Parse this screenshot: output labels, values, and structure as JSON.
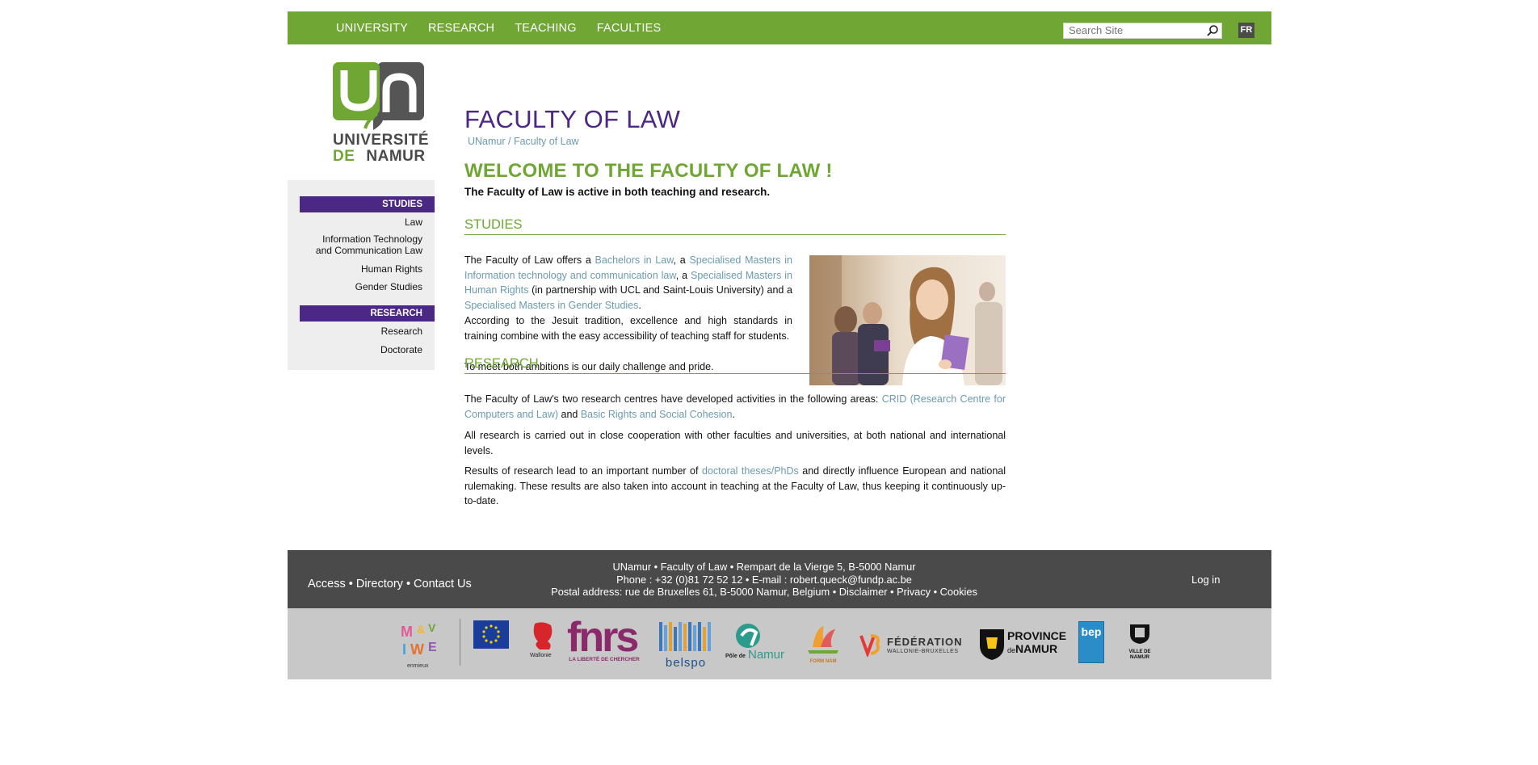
{
  "nav": {
    "items": [
      "UNIVERSITY",
      "RESEARCH",
      "TEACHING",
      "FACULTIES"
    ]
  },
  "search": {
    "placeholder": "Search Site"
  },
  "lang": {
    "label": "FR"
  },
  "logo": {
    "line1": "UNIVERSITÉ",
    "line2_de": "DE",
    "line2_rest": "NAMUR"
  },
  "sidebar": {
    "studies_header": "STUDIES",
    "studies_items": [
      "Law",
      "Information Technology",
      "and Communication Law",
      "Human Rights",
      "Gender Studies"
    ],
    "research_header": "RESEARCH",
    "research_items": [
      "Research",
      "Doctorate"
    ]
  },
  "page": {
    "title": "FACULTY OF LAW",
    "breadcrumb": "UNamur / Faculty of Law",
    "welcome": "WELCOME TO THE FACULTY OF LAW !",
    "intro": "The Faculty of Law is active in both teaching and research."
  },
  "studies": {
    "heading": "STUDIES",
    "p1": {
      "t1": "The Faculty of Law offers a ",
      "l1": "Bachelors in Law",
      "t2": ", a ",
      "l2": "Specialised Masters in Information technology and communication law",
      "t3": ", a ",
      "l3": "Specialised Masters in Human Rights",
      "t4": " (in partnership with UCL and Saint-Louis University) and a ",
      "l4": "Specialised Masters in Gender Studies",
      "t5": "."
    },
    "p2": "According to the Jesuit tradition, excellence and high standards in training combine with the easy accessibility of teaching staff for students.",
    "p3": "To meet both ambitions is our daily challenge and pride."
  },
  "research": {
    "heading": "RESEARCH",
    "p1": {
      "t1": "The Faculty of Law's two research centres have developed activities in the following areas: ",
      "l1": "CRID (Research Centre for Computers and Law)",
      "t2": " and ",
      "l2": "Basic Rights and Social Cohesion",
      "t3": "."
    },
    "p2": "All research is carried out in close cooperation with other faculties and universities, at both national and international levels.",
    "p3": {
      "t1": "Results of research lead to an important number of ",
      "l1": "doctoral theses/PhDs",
      "t2": " and directly influence European and national rulemaking. These results are also taken into account in teaching at the Faculty of Law, thus keeping it continuously up-to-date."
    }
  },
  "footer": {
    "access": "Access",
    "directory": "Directory",
    "contact": "Contact Us",
    "line1": "UNamur • Faculty of Law • Rempart de la Vierge 5, B-5000 Namur",
    "line2": "Phone : +32 (0)81 72 52 12 • E-mail : robert.queck@fundp.ac.be",
    "line3_prefix": "Postal address: rue de Bruxelles 61, B-5000 Namur, Belgium • ",
    "disclaimer": "Disclaimer",
    "privacy": "Privacy",
    "cookies": "Cookies",
    "login": "Log in"
  },
  "partners": {
    "wallonie": "Wallonie",
    "fnrs": "fnrs",
    "fnrs_tag": "LA LIBERTÉ DE CHERCHER",
    "belspo": "belspo",
    "pole_a": "Pôle de",
    "pole_b": "Namur",
    "forem": "FORM NAM",
    "federation_1": "FÉDÉRATION",
    "federation_2": "WALLONIE-BRUXELLES",
    "province_1": "PROVINCE",
    "province_de": "de",
    "province_2": "NAMUR",
    "bep": "bep",
    "ville_1": "VILLE DE",
    "ville_2": "NAMUR",
    "enmieux": "enmieux"
  },
  "colors": {
    "green": "#6fa634",
    "purple": "#4a2883",
    "link": "#6b9aae",
    "footer": "#4a4a4a",
    "partners_bg": "#c8c8c8"
  }
}
